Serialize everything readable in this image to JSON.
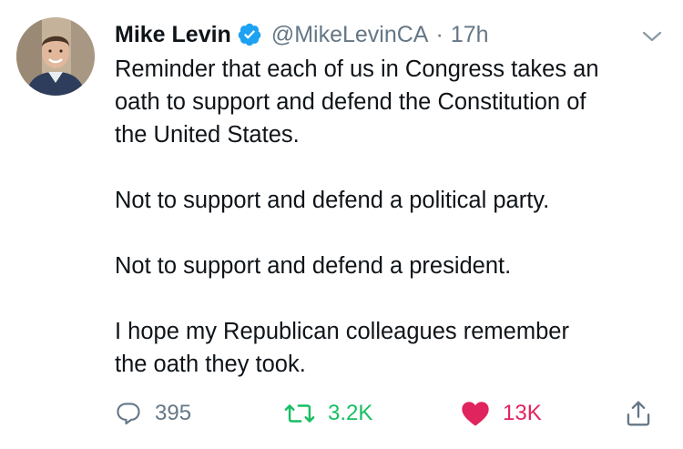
{
  "tweet": {
    "author": {
      "name": "Mike Levin",
      "handle": "@MikeLevinCA",
      "verified": true,
      "avatar_icon": "profile-photo"
    },
    "separator": "·",
    "time": "17h",
    "text": {
      "p1_line1": "Reminder that each of us in Congress takes an",
      "p1_line2": "oath to support and defend the Constitution of",
      "p1_line3": "the United States.",
      "p2": "Not to support and defend a political party.",
      "p3": "Not to support and defend a president.",
      "p4_line1": "I hope my Republican colleagues remember",
      "p4_line2": "the oath they took."
    },
    "actions": {
      "replies": "395",
      "retweets": "3.2K",
      "likes": "13K"
    }
  },
  "colors": {
    "text": "#0f1419",
    "secondary": "#657786",
    "verified_blue": "#1da1f2",
    "retweet_green": "#17bf63",
    "like_red": "#e0245e"
  },
  "icons": {
    "reply": "reply-bubble-icon",
    "retweet": "retweet-icon",
    "like": "heart-icon",
    "share": "share-icon",
    "menu": "chevron-down-icon",
    "verified": "verified-badge-icon"
  }
}
